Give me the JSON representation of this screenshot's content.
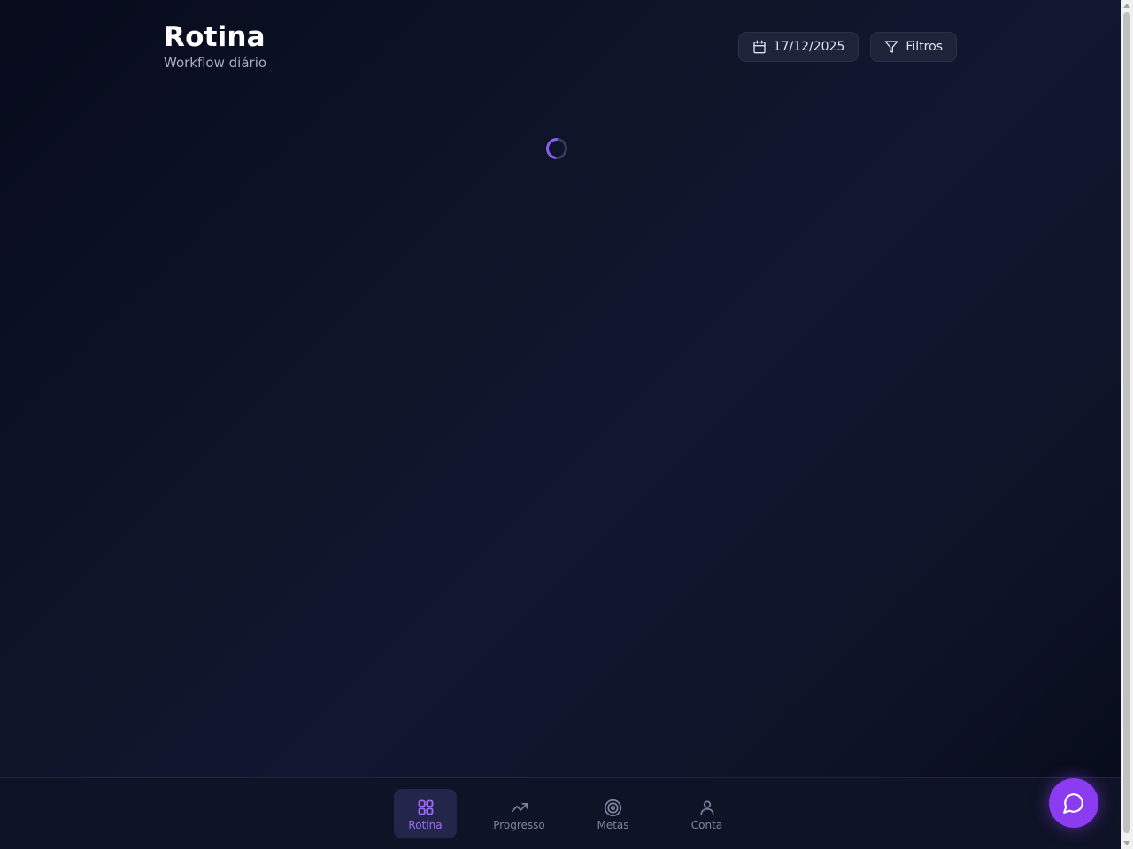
{
  "header": {
    "title": "Rotina",
    "subtitle": "Workflow diário",
    "date_label": "17/12/2025",
    "filters_label": "Filtros"
  },
  "nav": {
    "items": [
      {
        "label": "Rotina",
        "icon": "grid-icon",
        "active": true
      },
      {
        "label": "Progresso",
        "icon": "trending-up-icon",
        "active": false
      },
      {
        "label": "Metas",
        "icon": "target-icon",
        "active": false
      },
      {
        "label": "Conta",
        "icon": "user-icon",
        "active": false
      }
    ]
  },
  "fab": {
    "icon": "chat-icon"
  },
  "colors": {
    "accent": "#8b5cf6",
    "fab": "#8b3cf0",
    "background": "#0f1428",
    "active_nav_bg": "#23264a"
  }
}
